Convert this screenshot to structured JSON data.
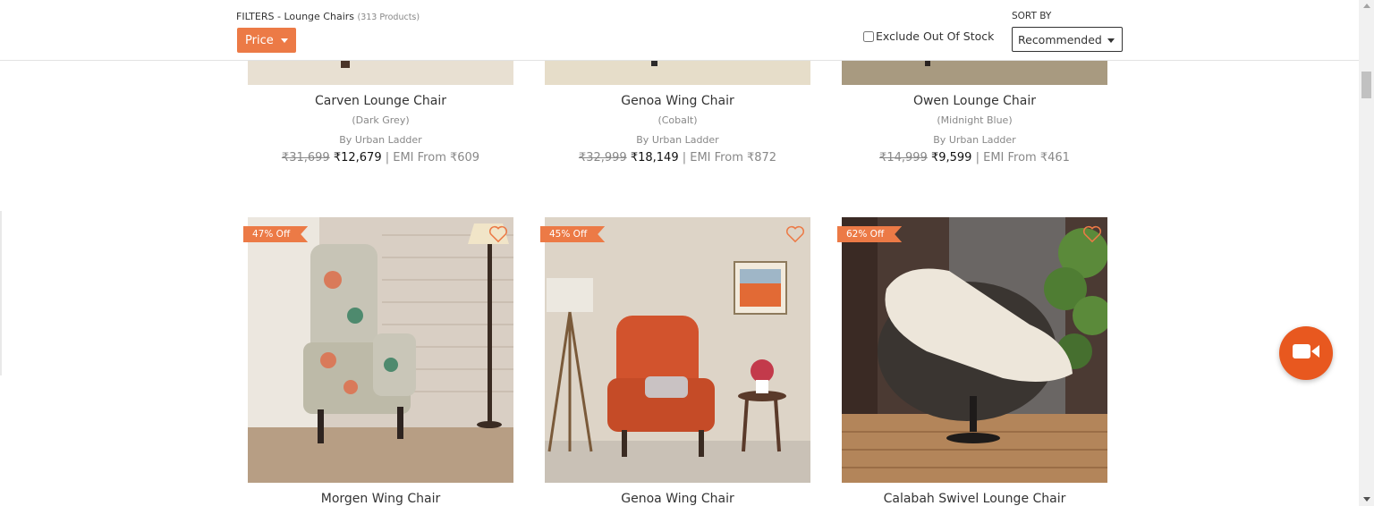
{
  "filter_bar": {
    "filters_label": "FILTERS - Lounge Chairs",
    "product_count": "(313 Products)",
    "price_button": "Price",
    "exclude_out_of_stock": "Exclude Out Of Stock",
    "sort_by_label": "SORT BY",
    "sort_selected": "Recommended"
  },
  "products_row1": [
    {
      "name": "Carven Lounge Chair",
      "variant": "(Dark Grey)",
      "brand": "By Urban Ladder",
      "mrp": "₹31,699",
      "price": "₹12,679",
      "emi": "| EMI From ₹609"
    },
    {
      "name": "Genoa Wing Chair",
      "variant": "(Cobalt)",
      "brand": "By Urban Ladder",
      "mrp": "₹32,999",
      "price": "₹18,149",
      "emi": "| EMI From ₹872"
    },
    {
      "name": "Owen Lounge Chair",
      "variant": "(Midnight Blue)",
      "brand": "By Urban Ladder",
      "mrp": "₹14,999",
      "price": "₹9,599",
      "emi": "| EMI From ₹461"
    }
  ],
  "products_row2": [
    {
      "name": "Morgen Wing Chair",
      "badge": "47% Off"
    },
    {
      "name": "Genoa Wing Chair",
      "badge": "45% Off"
    },
    {
      "name": "Calabah Swivel Lounge Chair",
      "badge": "62% Off"
    }
  ],
  "icons": {
    "wishlist": "heart-outline-icon",
    "video_call": "video-camera-icon",
    "dropdown": "caret-down-icon"
  },
  "colors": {
    "accent": "#ec7a46",
    "fab": "#e8581f"
  }
}
